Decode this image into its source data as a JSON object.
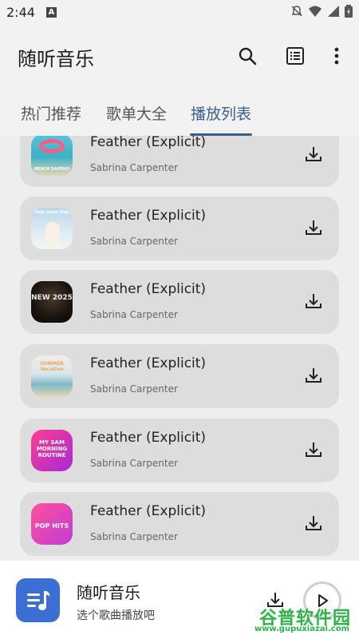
{
  "status": {
    "time": "2:44",
    "badge": "A"
  },
  "header": {
    "title": "随听音乐"
  },
  "tabs": [
    {
      "label": "热门推荐"
    },
    {
      "label": "歌单大全"
    },
    {
      "label": "播放列表"
    }
  ],
  "active_tab": "播放列表",
  "songs": [
    {
      "title": "Feather (Explicit)",
      "artist": "Sabrina Carpenter",
      "cover_caption": "BEACH SAPPHO"
    },
    {
      "title": "Feather (Explicit)",
      "artist": "Sabrina Carpenter",
      "cover_caption": "Vale Laura Pop"
    },
    {
      "title": "Feather (Explicit)",
      "artist": "Sabrina Carpenter",
      "cover_caption": "NEW 2025"
    },
    {
      "title": "Feather (Explicit)",
      "artist": "Sabrina Carpenter",
      "cover_caption": "SUMMER Vacation"
    },
    {
      "title": "Feather (Explicit)",
      "artist": "Sabrina Carpenter",
      "cover_caption": "MY SAM MORNING ROUTINE"
    },
    {
      "title": "Feather (Explicit)",
      "artist": "Sabrina Carpenter",
      "cover_caption": "POP HITS"
    }
  ],
  "player": {
    "title": "随听音乐",
    "subtitle": "选个歌曲播放吧"
  },
  "watermark": {
    "name": "谷普软件园",
    "url": "www.gupuxiazai.com"
  },
  "colors": {
    "accent": "#3a5f8e",
    "player_art": "#3b6fd4",
    "card": "#dddddd",
    "background": "#eeeeee"
  }
}
